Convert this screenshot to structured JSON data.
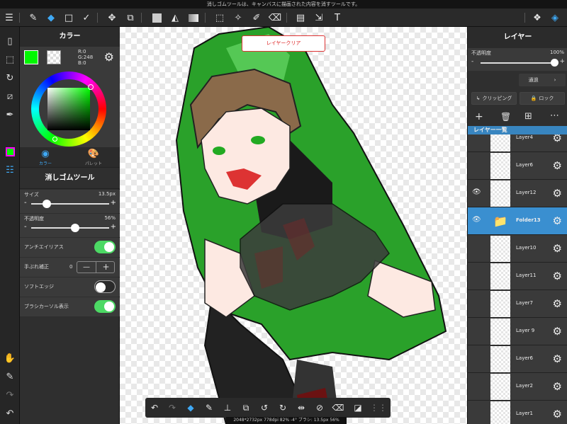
{
  "hint": "消しゴムツールは、キャンバスに描画された内容を消すツールです。",
  "colors": {
    "accent": "#3fa9f5",
    "fg": "#00f800",
    "toggle_on": "#4cd964",
    "selected_layer": "#3a8fd0"
  },
  "toolbar": {
    "left": [
      "menu-icon",
      "brush-icon",
      "eraser-icon",
      "rectangle-icon",
      "check-pen-icon",
      "move-icon",
      "transform-icon",
      "fill-rect-icon",
      "bucket-icon",
      "gradient-icon",
      "select-rect-icon",
      "magic-wand-icon",
      "select-pen-icon",
      "select-eraser-icon",
      "layout-icon",
      "select-move-icon",
      "text-icon"
    ],
    "right": [
      "material-icon",
      "layers-icon"
    ]
  },
  "color_panel": {
    "title": "カラー",
    "r": "R:0",
    "g": "G:248",
    "b": "B:0",
    "tab_color": "カラー",
    "tab_palette": "パレット"
  },
  "tool_panel": {
    "title": "消しゴムツール",
    "size_label": "サイズ",
    "size_value": "13.5px",
    "size_level": 0.2,
    "opacity_label": "不透明度",
    "opacity_value": "56%",
    "opacity_level": 0.56,
    "antialias_label": "アンチエイリアス",
    "antialias_on": true,
    "stabilizer_label": "手ぶれ補正",
    "stabilizer_value": "0",
    "softedge_label": "ソフトエッジ",
    "softedge_on": false,
    "cursor_label": "ブラシカーソル表示",
    "cursor_on": true,
    "minus": "-",
    "plus": "+"
  },
  "canvas": {
    "clear_button": "レイヤークリア",
    "status": "2048*2732px 778dpi 82% -4° ブラシ: 13.5px 56%"
  },
  "bottom_bar": [
    "undo-icon",
    "redo-icon",
    "eraser-icon",
    "eyedropper-icon",
    "fill-icon",
    "transform-icon",
    "rotate-left-icon",
    "rotate-right-icon",
    "flip-icon",
    "no-snap-icon",
    "clear-icon",
    "edit-icon",
    "grid-icon"
  ],
  "layer_panel": {
    "title": "レイヤー",
    "opacity_label": "不透明度",
    "opacity_value": "100%",
    "opacity_level": 1.0,
    "blend_mode": "通過",
    "clipping": "クリッピング",
    "lock": "ロック",
    "list_title": "レイヤー一覧",
    "minus": "-",
    "plus": "+",
    "layers": [
      {
        "name": "Layer4",
        "eye": false,
        "selected": false
      },
      {
        "name": "Layer6",
        "eye": false,
        "selected": false
      },
      {
        "name": "Layer12",
        "eye": true,
        "selected": false
      },
      {
        "name": "Folder13",
        "eye": true,
        "selected": true
      },
      {
        "name": "Layer10",
        "eye": false,
        "selected": false
      },
      {
        "name": "Layer11",
        "eye": false,
        "selected": false
      },
      {
        "name": "Layer7",
        "eye": false,
        "selected": false
      },
      {
        "name": "Layer 9",
        "eye": false,
        "selected": false
      },
      {
        "name": "Layer6",
        "eye": false,
        "selected": false
      },
      {
        "name": "Layer2",
        "eye": false,
        "selected": false
      },
      {
        "name": "Layer1",
        "eye": false,
        "selected": false
      }
    ]
  }
}
